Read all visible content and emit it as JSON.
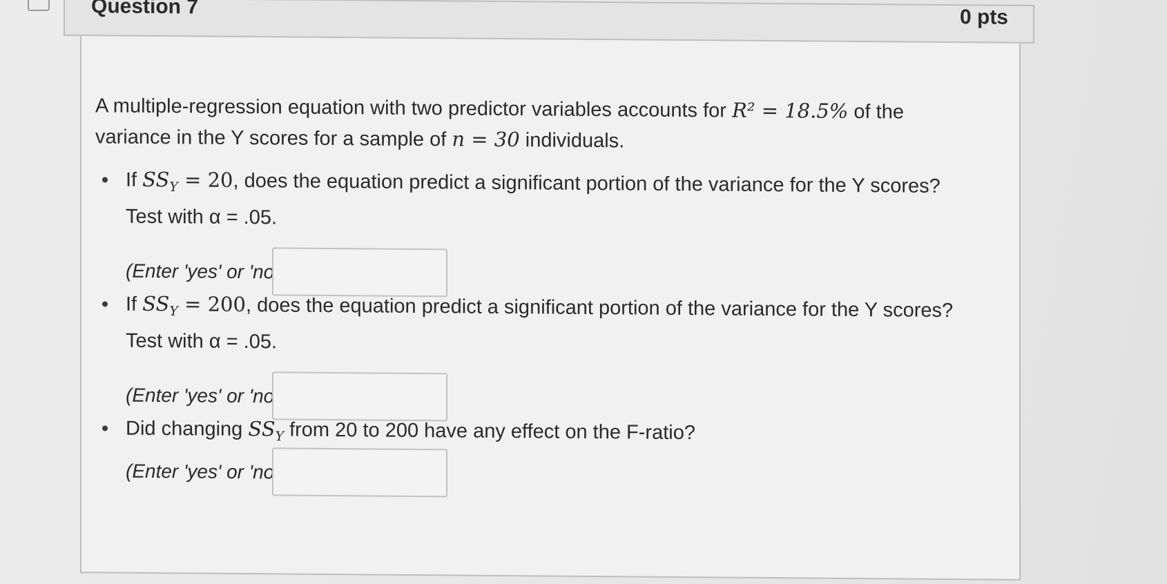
{
  "header": {
    "title": "Question 7",
    "points": "0 pts"
  },
  "intro": {
    "part1": "A multiple-regression equation with two predictor variables accounts for ",
    "r_squared": "R² = 18.5%",
    "part2": " of the",
    "line2_a": "variance in the Y scores for a sample of ",
    "n_value": "n = 30",
    "line2_b": " individuals."
  },
  "items": [
    {
      "prefix": "If ",
      "math": "SS",
      "sub": "Y",
      "equals": " = 20",
      "rest": ", does the equation predict a significant portion of the variance for the Y scores?",
      "line2": "Test with α = .05.",
      "answer_label": "(Enter 'yes' or 'no')",
      "answer_value": ""
    },
    {
      "prefix": "If ",
      "math": "SS",
      "sub": "Y",
      "equals": " = 200",
      "rest": ", does the equation predict a significant portion of the variance for the Y scores?",
      "line2": "Test with α = .05.",
      "answer_label": "(Enter 'yes' or 'no')",
      "answer_value": ""
    },
    {
      "prefix": "Did changing ",
      "math": "SS",
      "sub": "Y",
      "rest": " from 20 to 200 have any effect on the F-ratio?",
      "answer_label": "(Enter 'yes' or 'no')",
      "answer_value": ""
    }
  ]
}
